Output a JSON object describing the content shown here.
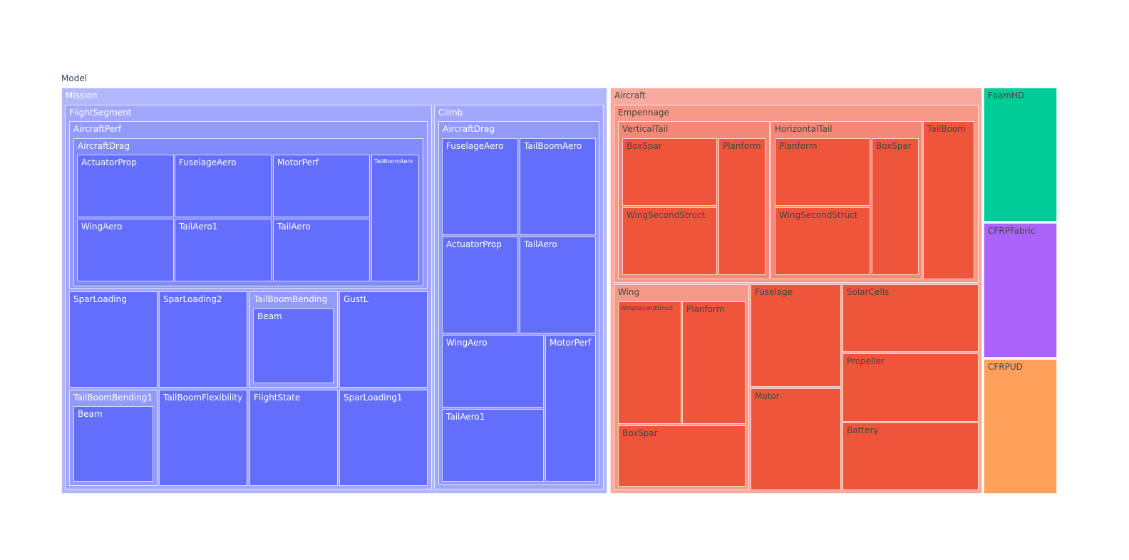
{
  "chart_data": {
    "type": "treemap",
    "title": "",
    "root": {
      "label": "Model",
      "children": [
        {
          "label": "Mission",
          "color": "#636efa",
          "children": [
            {
              "label": "FlightSegment",
              "children": [
                {
                  "label": "AircraftPerf",
                  "children": [
                    {
                      "label": "AircraftDrag",
                      "children": [
                        {
                          "label": "ActuatorProp",
                          "value": 1
                        },
                        {
                          "label": "FuselageAero",
                          "value": 1
                        },
                        {
                          "label": "MotorPerf",
                          "value": 1
                        },
                        {
                          "label": "WingAero",
                          "value": 1
                        },
                        {
                          "label": "TailAero1",
                          "value": 1
                        },
                        {
                          "label": "TailAero",
                          "value": 1
                        },
                        {
                          "label": "TailBoomAero",
                          "value": 1
                        }
                      ]
                    }
                  ]
                },
                {
                  "label": "SparLoading",
                  "value": 1
                },
                {
                  "label": "SparLoading2",
                  "value": 1
                },
                {
                  "label": "TailBoomBending",
                  "children": [
                    {
                      "label": "Beam",
                      "value": 1
                    }
                  ]
                },
                {
                  "label": "GustL",
                  "value": 1
                },
                {
                  "label": "TailBoomBending1",
                  "children": [
                    {
                      "label": "Beam",
                      "value": 1
                    }
                  ]
                },
                {
                  "label": "TailBoomFlexibility",
                  "value": 1
                },
                {
                  "label": "FlightState",
                  "value": 1
                },
                {
                  "label": "SparLoading1",
                  "value": 1
                }
              ]
            },
            {
              "label": "Climb",
              "children": [
                {
                  "label": "AircraftDrag",
                  "children": [
                    {
                      "label": "FuselageAero",
                      "value": 1
                    },
                    {
                      "label": "TailBoomAero",
                      "value": 1
                    },
                    {
                      "label": "ActuatorProp",
                      "value": 1
                    },
                    {
                      "label": "TailAero",
                      "value": 1
                    },
                    {
                      "label": "WingAero",
                      "value": 1
                    },
                    {
                      "label": "TailAero1",
                      "value": 1
                    },
                    {
                      "label": "MotorPerf",
                      "value": 1
                    }
                  ]
                }
              ]
            }
          ]
        },
        {
          "label": "Aircraft",
          "color": "#ef553b",
          "children": [
            {
              "label": "Empennage",
              "children": [
                {
                  "label": "VerticalTail",
                  "children": [
                    {
                      "label": "BoxSpar",
                      "value": 1
                    },
                    {
                      "label": "WingSecondStruct",
                      "value": 1
                    },
                    {
                      "label": "Planform",
                      "value": 1
                    }
                  ]
                },
                {
                  "label": "HorizontalTail",
                  "children": [
                    {
                      "label": "Planform",
                      "value": 1
                    },
                    {
                      "label": "WingSecondStruct",
                      "value": 1
                    },
                    {
                      "label": "BoxSpar",
                      "value": 1
                    }
                  ]
                },
                {
                  "label": "TailBoom",
                  "value": 1
                }
              ]
            },
            {
              "label": "Wing",
              "children": [
                {
                  "label": "WingSecondStruct",
                  "value": 1
                },
                {
                  "label": "Planform",
                  "value": 1
                },
                {
                  "label": "BoxSpar",
                  "value": 1
                }
              ]
            },
            {
              "label": "Fuselage",
              "value": 1
            },
            {
              "label": "Motor",
              "value": 1
            },
            {
              "label": "SolarCells",
              "value": 1
            },
            {
              "label": "Propeller",
              "value": 1
            },
            {
              "label": "Battery",
              "value": 1
            }
          ]
        },
        {
          "label": "FoamHD",
          "value": 1,
          "color": "#00cc96"
        },
        {
          "label": "CFRPFabric",
          "value": 1,
          "color": "#ab63fa"
        },
        {
          "label": "CFRPUD",
          "value": 1,
          "color": "#ffa15a"
        }
      ]
    }
  }
}
